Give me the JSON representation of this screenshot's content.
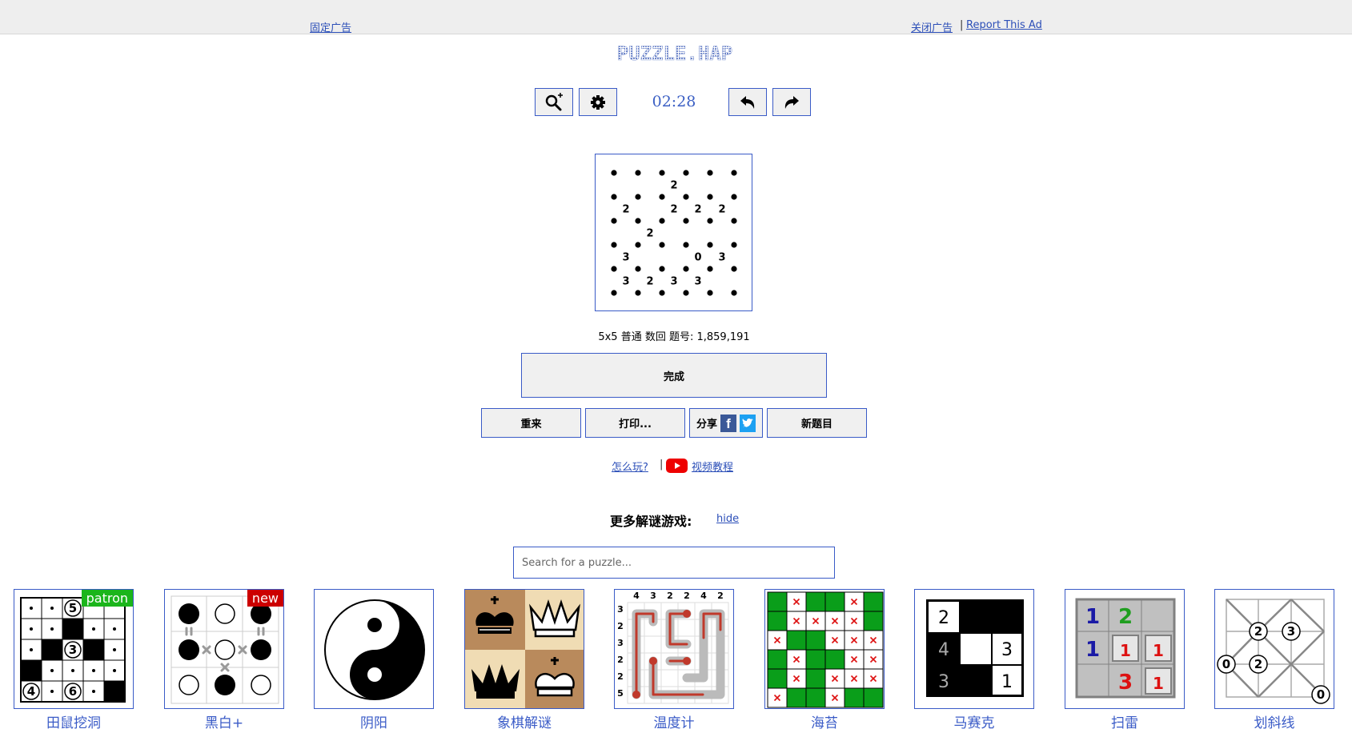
{
  "ads": {
    "fixed_ad": "固定广告",
    "close_ad": "关闭广告",
    "separator": "|",
    "report_ad": "Report This Ad"
  },
  "logo": {
    "text": "PUZZLE.HAP"
  },
  "toolbar": {
    "zoom_icon": "zoom-in-icon",
    "settings_icon": "gear-icon",
    "timer": "02:28",
    "undo_icon": "undo-icon",
    "redo_icon": "redo-icon"
  },
  "puzzle": {
    "size": 5,
    "clues": [
      [
        "",
        "",
        "2",
        "",
        ""
      ],
      [
        "2",
        "",
        "2",
        "2",
        "2"
      ],
      [
        "",
        "2",
        "",
        "",
        ""
      ],
      [
        "3",
        "",
        "",
        "0",
        "3"
      ],
      [
        "3",
        "2",
        "3",
        "3",
        ""
      ]
    ],
    "info": "5x5 普通 数回 题号: 1,859,191"
  },
  "actions": {
    "done": "完成",
    "restart": "重来",
    "print": "打印...",
    "share": "分享",
    "new": "新题目"
  },
  "help": {
    "how_to_play": "怎么玩?",
    "separator": "|",
    "video_tutorial": "视频教程"
  },
  "more": {
    "title": "更多解谜游戏:",
    "hide": "hide",
    "search_placeholder": "Search for a puzzle..."
  },
  "games": [
    {
      "label": "田鼠挖洞",
      "badge": "patron",
      "badge_color": "#1bb51b"
    },
    {
      "label": "黑白+",
      "badge": "new",
      "badge_color": "#cc0000"
    },
    {
      "label": "阴阳"
    },
    {
      "label": "象棋解谜"
    },
    {
      "label": "温度计"
    },
    {
      "label": "海苔"
    },
    {
      "label": "马赛克"
    },
    {
      "label": "扫雷"
    },
    {
      "label": "划斜线"
    }
  ],
  "thumbnail_text": {
    "dig": [
      [
        "5",
        "·"
      ],
      [
        "3"
      ],
      [
        "4",
        "6"
      ]
    ],
    "thermo_top": [
      "4",
      "3",
      "2",
      "2",
      "4",
      "2"
    ],
    "thermo_left": [
      "3",
      "2",
      "3",
      "2",
      "2",
      "5"
    ],
    "mosaic": [
      "2",
      "4",
      "3",
      "3",
      "1"
    ],
    "mines": [
      "1",
      "2",
      "1",
      "1",
      "1",
      "3",
      "1"
    ],
    "slant": [
      "2",
      "3",
      "0",
      "2",
      "0"
    ]
  },
  "colors": {
    "accent": "#3a5bc7",
    "seaweed_green": "#0a9e1a",
    "chess_dark": "#b98a5c",
    "chess_light": "#f0dcb4"
  }
}
